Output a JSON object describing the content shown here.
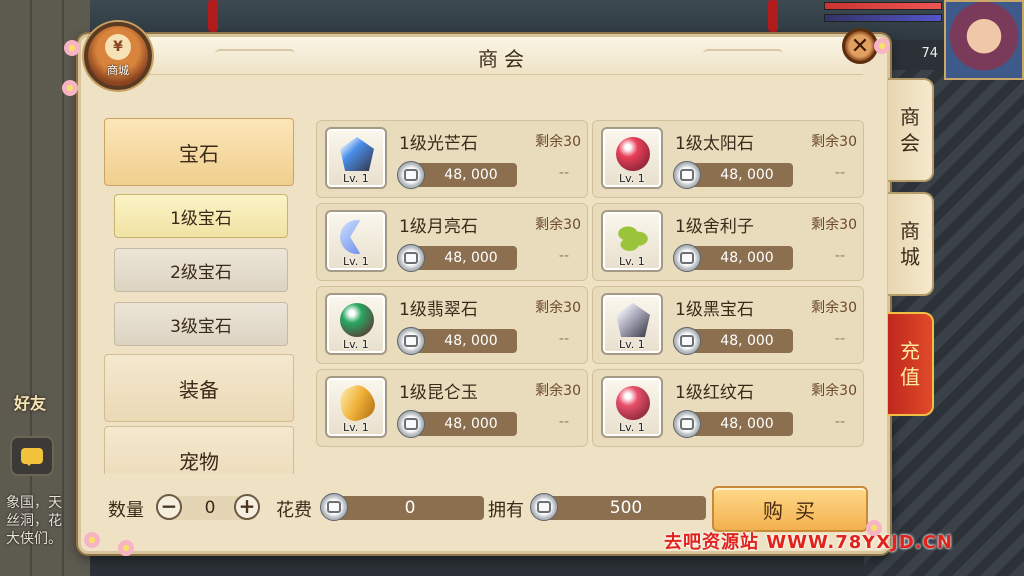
{
  "background": {
    "friend_label": "好友",
    "chat_lines": [
      "象国，天",
      "丝洞，花",
      "大侠们。"
    ],
    "player_level": "74"
  },
  "shop": {
    "title": "商会",
    "badge_label": "商城",
    "badge_coin": "¥",
    "close_symbol": "✕"
  },
  "categories": [
    {
      "label": "宝石",
      "active": true
    },
    {
      "label": "装备",
      "active": false
    },
    {
      "label": "宠物",
      "active": false
    }
  ],
  "subcategories": [
    {
      "label": "1级宝石",
      "active": true
    },
    {
      "label": "2级宝石",
      "active": false
    },
    {
      "label": "3级宝石",
      "active": false
    }
  ],
  "items": [
    {
      "name": "1级光芒石",
      "level": "Lv. 1",
      "price": "48, 000",
      "remain": "剩余30",
      "extra": "--",
      "color": "#4a8ee8",
      "shape": "crystal"
    },
    {
      "name": "1级太阳石",
      "level": "Lv. 1",
      "price": "48, 000",
      "remain": "剩余30",
      "extra": "--",
      "color": "#e8405a",
      "shape": "round"
    },
    {
      "name": "1级月亮石",
      "level": "Lv. 1",
      "price": "48, 000",
      "remain": "剩余30",
      "extra": "--",
      "color": "#5a7ee8",
      "shape": "moon"
    },
    {
      "name": "1级舍利子",
      "level": "Lv. 1",
      "price": "48, 000",
      "remain": "剩余30",
      "extra": "--",
      "color": "#9cc43a",
      "shape": "beans"
    },
    {
      "name": "1级翡翠石",
      "level": "Lv. 1",
      "price": "48, 000",
      "remain": "剩余30",
      "extra": "--",
      "color": "#2aa862",
      "shape": "round"
    },
    {
      "name": "1级黑宝石",
      "level": "Lv. 1",
      "price": "48, 000",
      "remain": "剩余30",
      "extra": "--",
      "color": "#b8b8c8",
      "shape": "crystal"
    },
    {
      "name": "1级昆仑玉",
      "level": "Lv. 1",
      "price": "48, 000",
      "remain": "剩余30",
      "extra": "--",
      "color": "#f0b23a",
      "shape": "pill"
    },
    {
      "name": "1级红纹石",
      "level": "Lv. 1",
      "price": "48, 000",
      "remain": "剩余30",
      "extra": "--",
      "color": "#e8506a",
      "shape": "round"
    }
  ],
  "side_tabs": [
    {
      "label": "商\n会"
    },
    {
      "label": "商\n城"
    },
    {
      "label": "充\n值"
    }
  ],
  "purchase": {
    "quantity_label": "数量",
    "quantity_value": "0",
    "minus": "−",
    "plus": "+",
    "cost_label": "花费",
    "cost_value": "0",
    "owned_label": "拥有",
    "owned_value": "500",
    "buy_label": "购买"
  },
  "watermark": "去吧资源站 WWW.78YXJD.CN",
  "colors": {
    "panel": "#efe2c4",
    "price_bar": "#8b6f4f",
    "recharge_tab": "#c0281c",
    "buy_button": "#f2b14e"
  }
}
